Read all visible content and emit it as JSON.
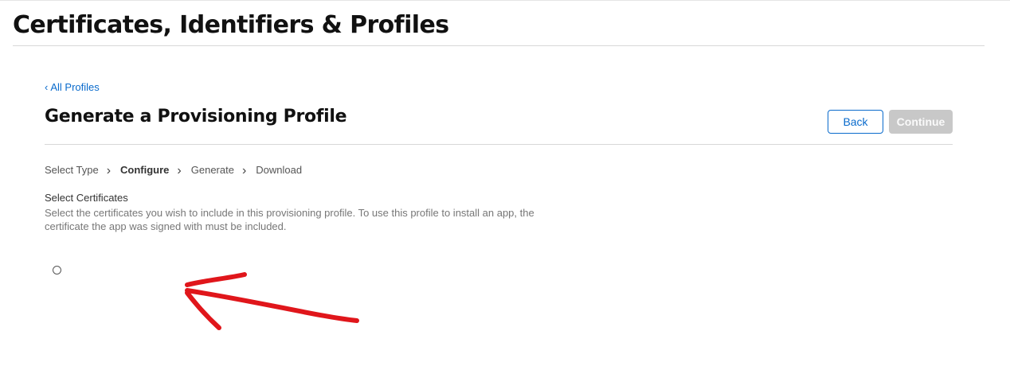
{
  "header": {
    "title": "Certificates, Identifiers & Profiles"
  },
  "nav": {
    "back_link": "All Profiles",
    "back_icon": "chevron-left-icon"
  },
  "section": {
    "title": "Generate a Provisioning Profile",
    "back_button": "Back",
    "continue_button": "Continue"
  },
  "steps": [
    {
      "label": "Select Type",
      "active": false
    },
    {
      "label": "Configure",
      "active": true
    },
    {
      "label": "Generate",
      "active": false
    },
    {
      "label": "Download",
      "active": false
    }
  ],
  "step_separator": "›",
  "certificates": {
    "title": "Select Certificates",
    "description": "Select the certificates you wish to include in this provisioning profile. To use this profile to install an app, the certificate the app was signed with must be included."
  },
  "colors": {
    "link": "#0a6bcc",
    "disabled_button": "#c8c8c8",
    "annotation_arrow": "#e0161b"
  }
}
